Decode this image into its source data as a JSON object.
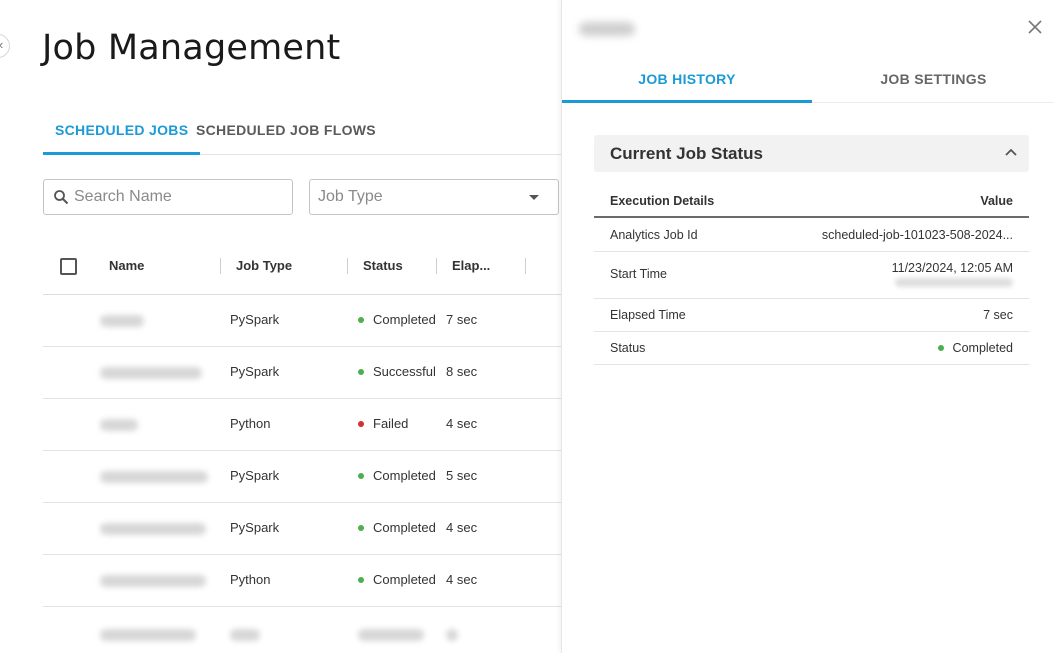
{
  "page": {
    "title": "Job Management"
  },
  "tabs": [
    {
      "label": "SCHEDULED JOBS",
      "active": true
    },
    {
      "label": "SCHEDULED JOB FLOWS",
      "active": false
    }
  ],
  "filters": {
    "search_placeholder": "Search Name",
    "job_type_placeholder": "Job Type"
  },
  "table": {
    "headers": [
      "Name",
      "Job Type",
      "Status",
      "Elap..."
    ],
    "rows": [
      {
        "name": "",
        "type": "PySpark",
        "status": "Completed",
        "elapsed": "7 sec"
      },
      {
        "name": "",
        "type": "PySpark",
        "status": "Successful",
        "elapsed": "8 sec"
      },
      {
        "name": "",
        "type": "Python",
        "status": "Failed",
        "elapsed": "4 sec"
      },
      {
        "name": "",
        "type": "PySpark",
        "status": "Completed",
        "elapsed": "5 sec"
      },
      {
        "name": "",
        "type": "PySpark",
        "status": "Completed",
        "elapsed": "4 sec"
      },
      {
        "name": "",
        "type": "Python",
        "status": "Completed",
        "elapsed": "4 sec"
      }
    ]
  },
  "colors": {
    "accent": "#1a9ad6",
    "status_success": "#4caf50",
    "status_failed": "#d32f2f"
  },
  "drawer": {
    "tabs": [
      {
        "label": "JOB HISTORY",
        "active": true
      },
      {
        "label": "JOB SETTINGS",
        "active": false
      }
    ],
    "section_title": "Current Job Status",
    "details_headers": [
      "Execution Details",
      "Value"
    ],
    "details": [
      {
        "key": "Analytics Job Id",
        "value": "scheduled-job-101023-508-2024..."
      },
      {
        "key": "Start Time",
        "value": "11/23/2024, 12:05 AM"
      },
      {
        "key": "Elapsed Time",
        "value": "7 sec"
      },
      {
        "key": "Status",
        "value": "Completed"
      }
    ]
  },
  "icons": {
    "search": "search-icon",
    "dropdown": "chevron-down-icon",
    "close": "close-icon",
    "collapse": "chevron-up-icon",
    "back": "chevron-left-icon"
  }
}
